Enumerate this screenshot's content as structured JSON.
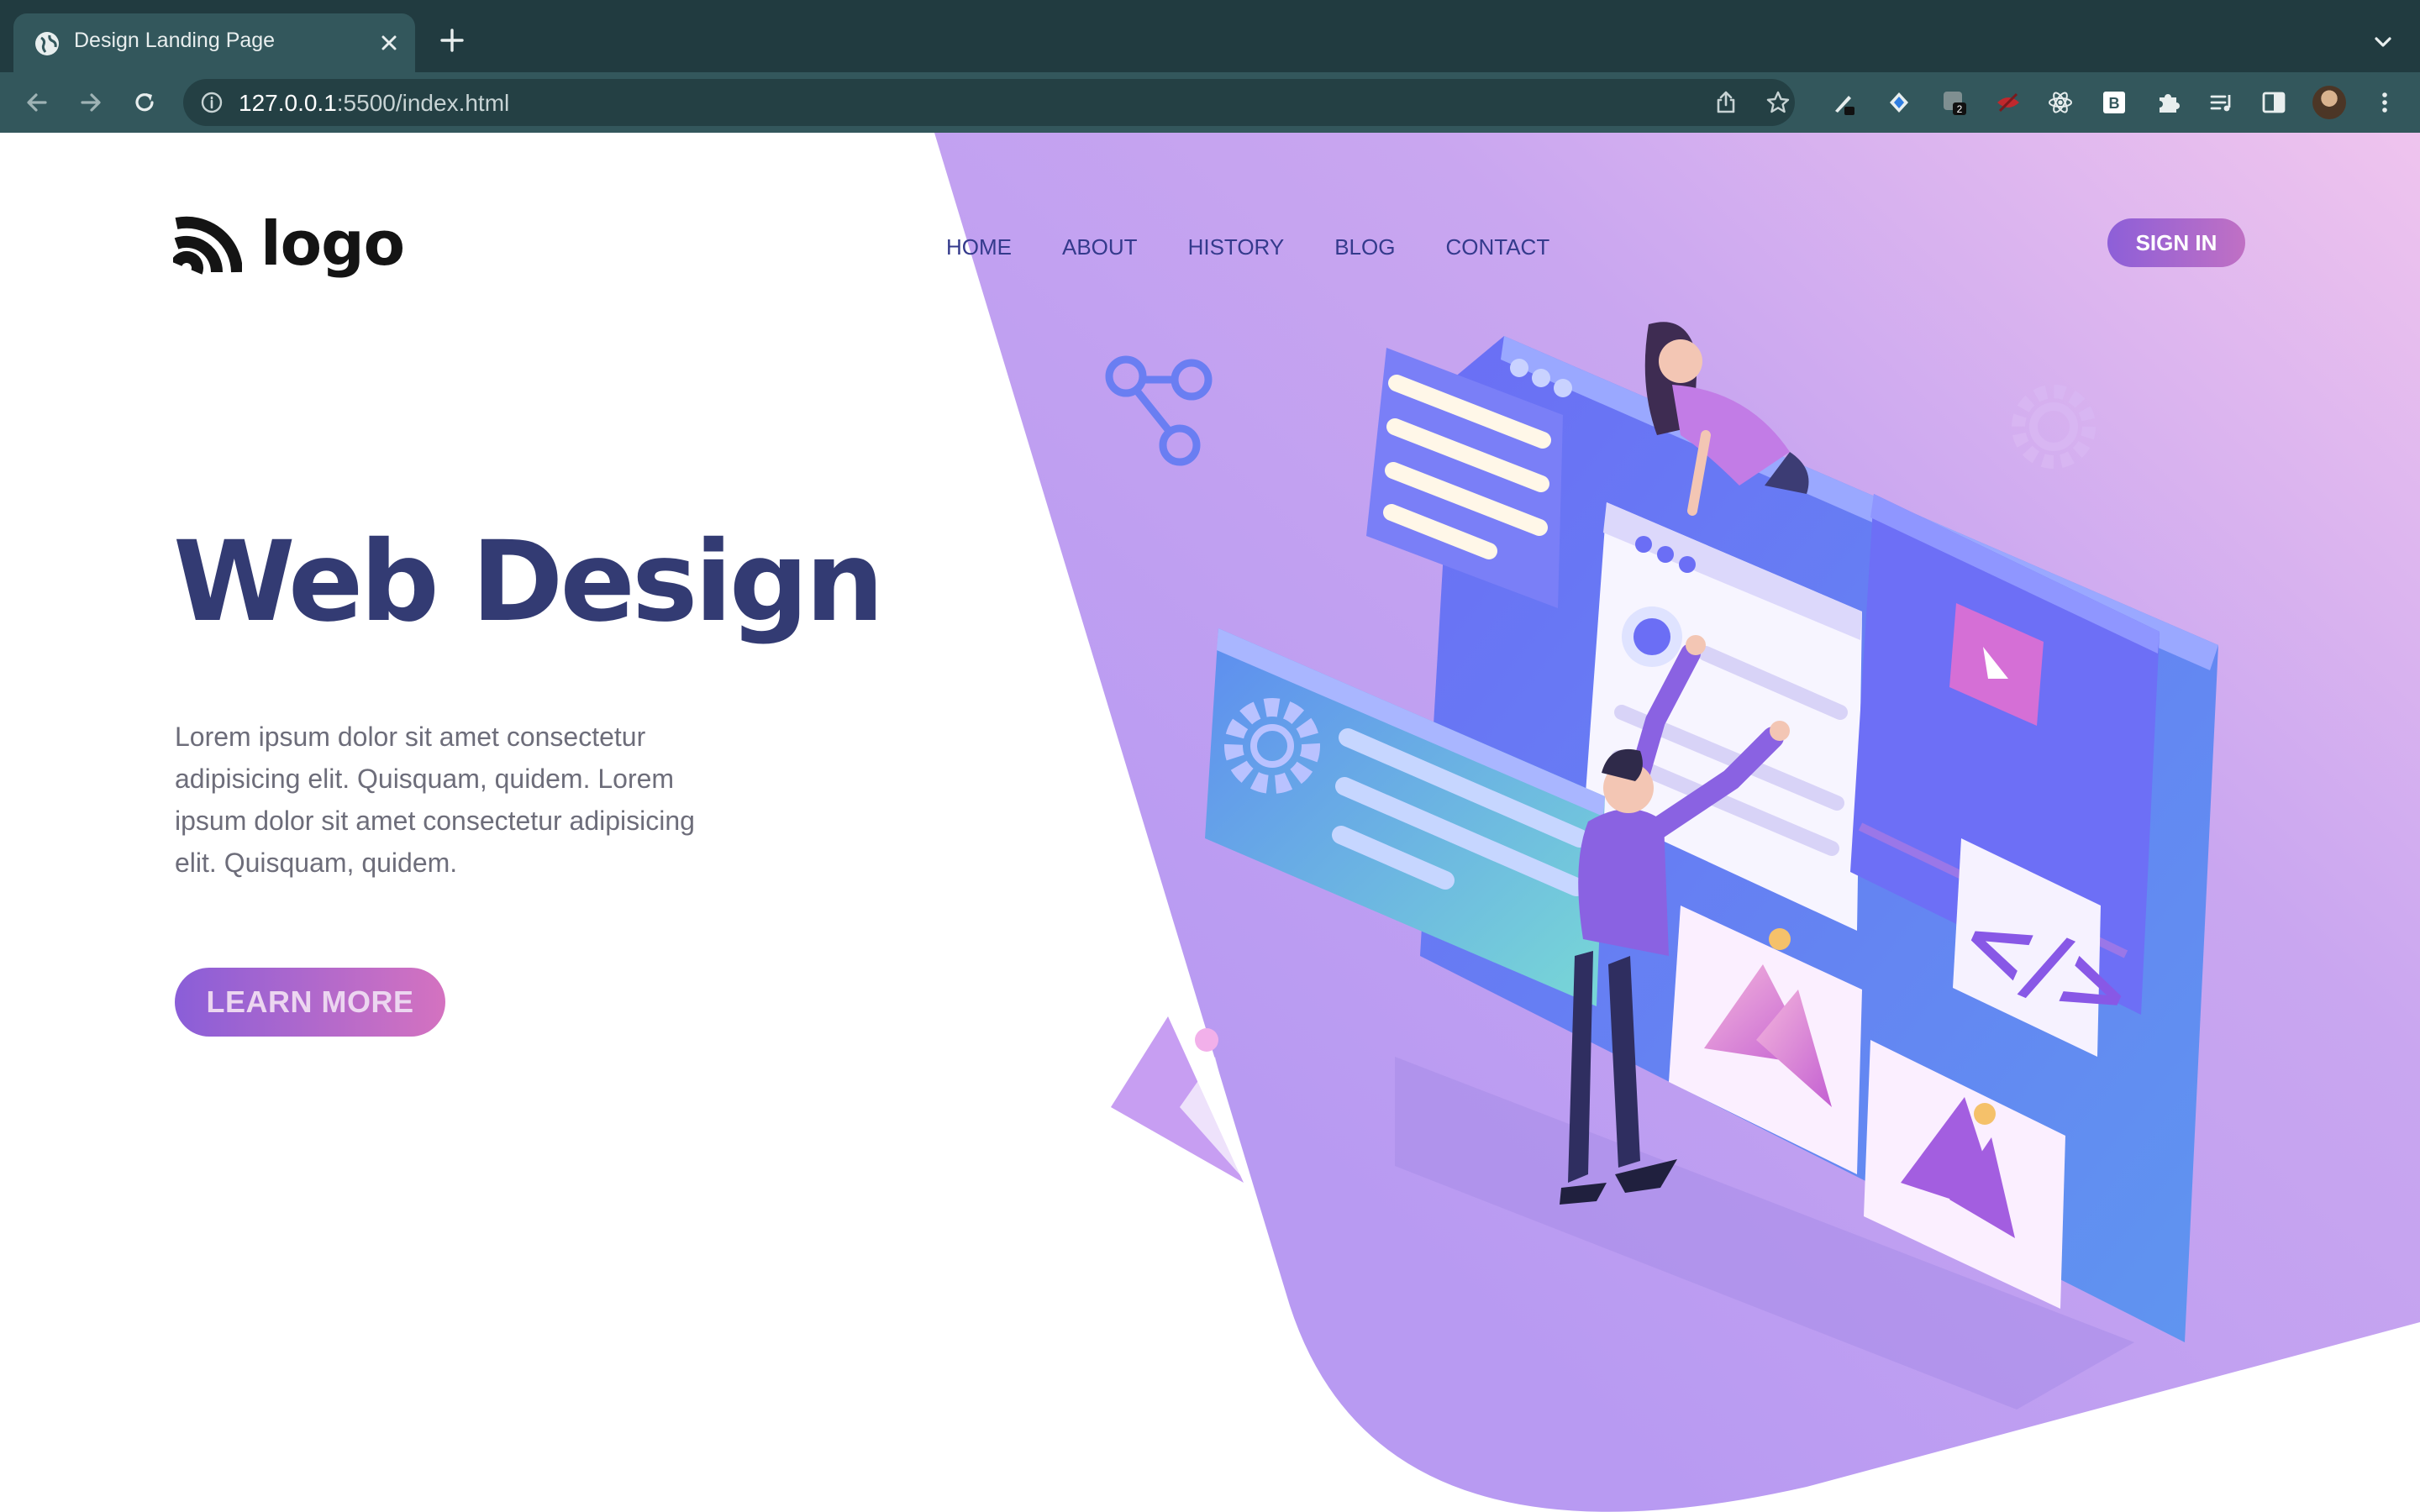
{
  "browser": {
    "tab_title": "Design Landing Page",
    "url_host": "127.0.0.1",
    "url_rest": ":5500/index.html",
    "extension_badge": "2",
    "extension_letter": "B",
    "icons": [
      "globe-icon",
      "close-icon",
      "plus-icon",
      "chevron-down-icon",
      "back-arrow-icon",
      "forward-arrow-icon",
      "reload-icon",
      "info-icon",
      "share-icon",
      "star-icon",
      "puzzle-icon",
      "sidebar-icon",
      "menu-dots-icon"
    ]
  },
  "page": {
    "logo_text": "logo",
    "nav": [
      "HOME",
      "ABOUT",
      "HISTORY",
      "BLOG",
      "CONTACT"
    ],
    "signin_label": "SIGN IN",
    "hero_title": "Web Design",
    "hero_text": "Lorem ipsum dolor sit amet consectetur adipisicing elit. Quisquam, quidem. Lorem ipsum dolor sit amet consectetur adipisicing elit. Quisquam, quidem.",
    "cta_label": "LEARN MORE"
  },
  "colors": {
    "chrome_dark": "#213b40",
    "chrome_toolbar": "#33575c",
    "hero_purple": "#b896f0",
    "hero_pink": "#eec2ee",
    "title": "#333b73",
    "nav_text": "#343a8c",
    "button_start": "#8a5ed8",
    "button_end": "#d472c0"
  }
}
